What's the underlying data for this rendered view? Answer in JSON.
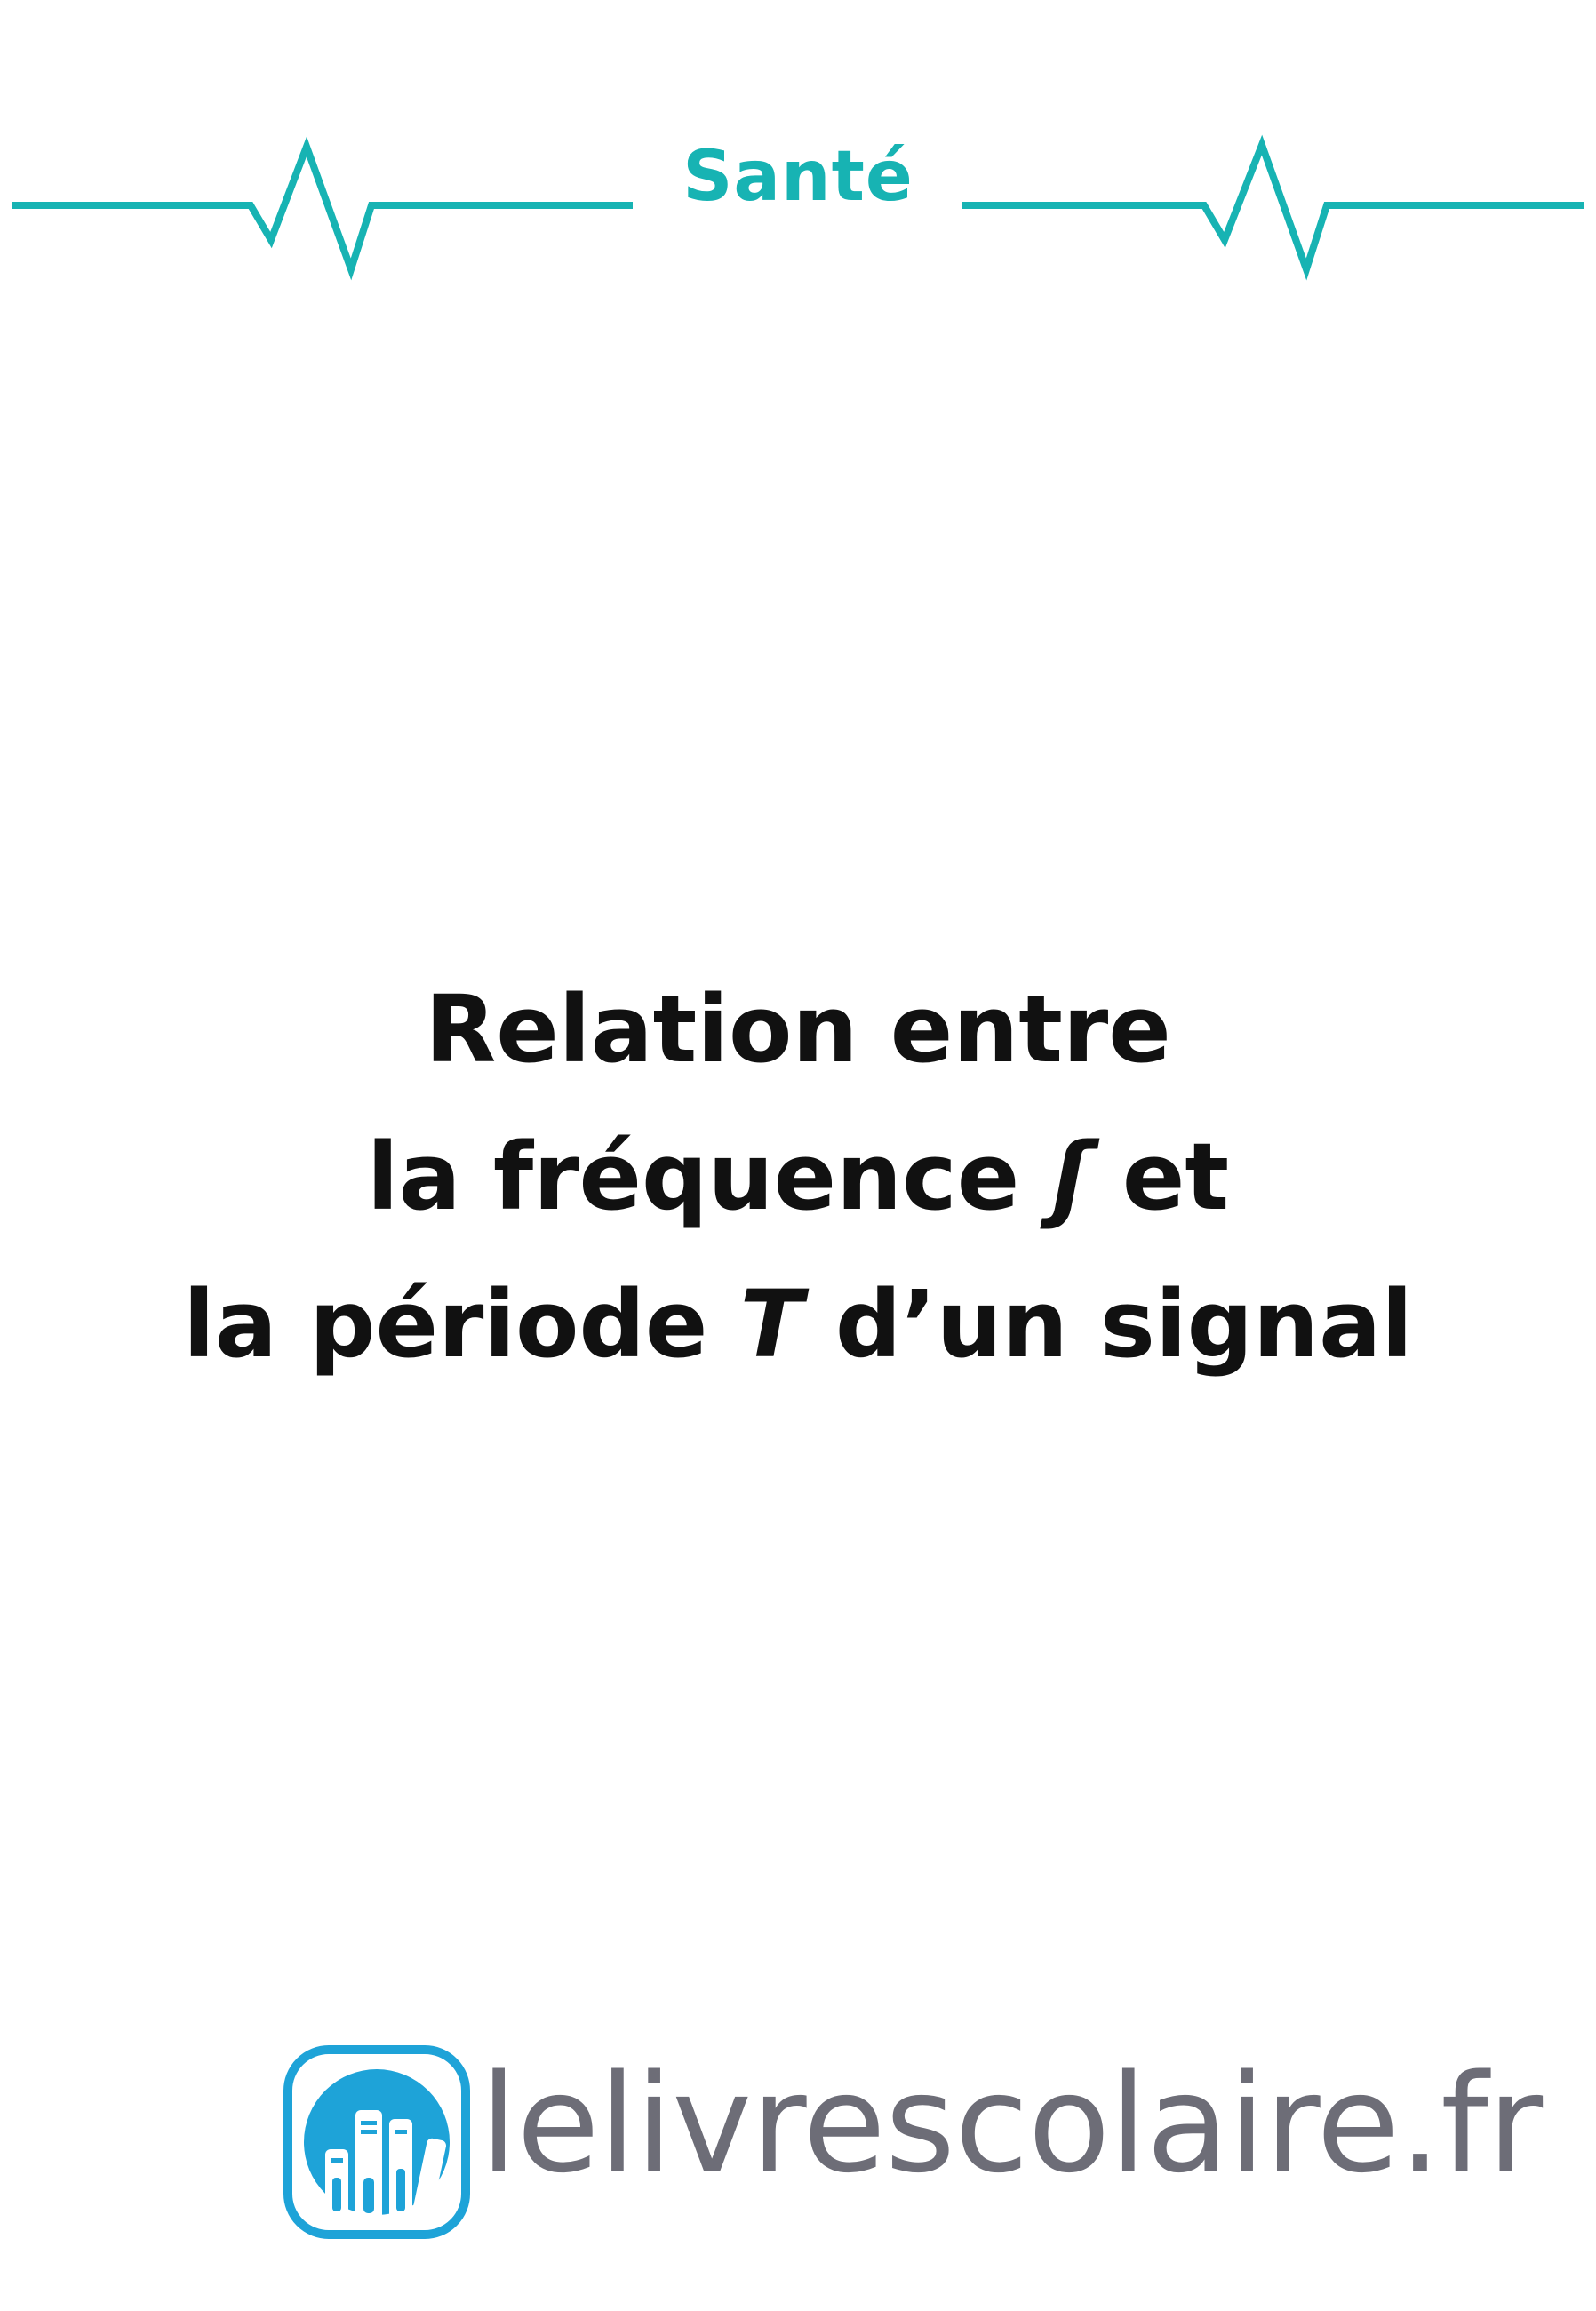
{
  "header": {
    "label": "Santé",
    "accent_color": "#17b3b3",
    "decoration": "heartbeat-line-icon"
  },
  "title": {
    "line1": "Relation entre",
    "line2_text": "la fréquence ",
    "line2_symbol": "ʃ",
    "line2_end": " et",
    "line3_start": "la période ",
    "line3_symbol": "T",
    "line3_end": " d’un signal",
    "color": "#111111"
  },
  "footer": {
    "logo_text": "lelivrescolaire.fr",
    "logo_icon": "books-logo-icon",
    "logo_color": "#1ea3d8",
    "text_color": "#6d6d77"
  }
}
